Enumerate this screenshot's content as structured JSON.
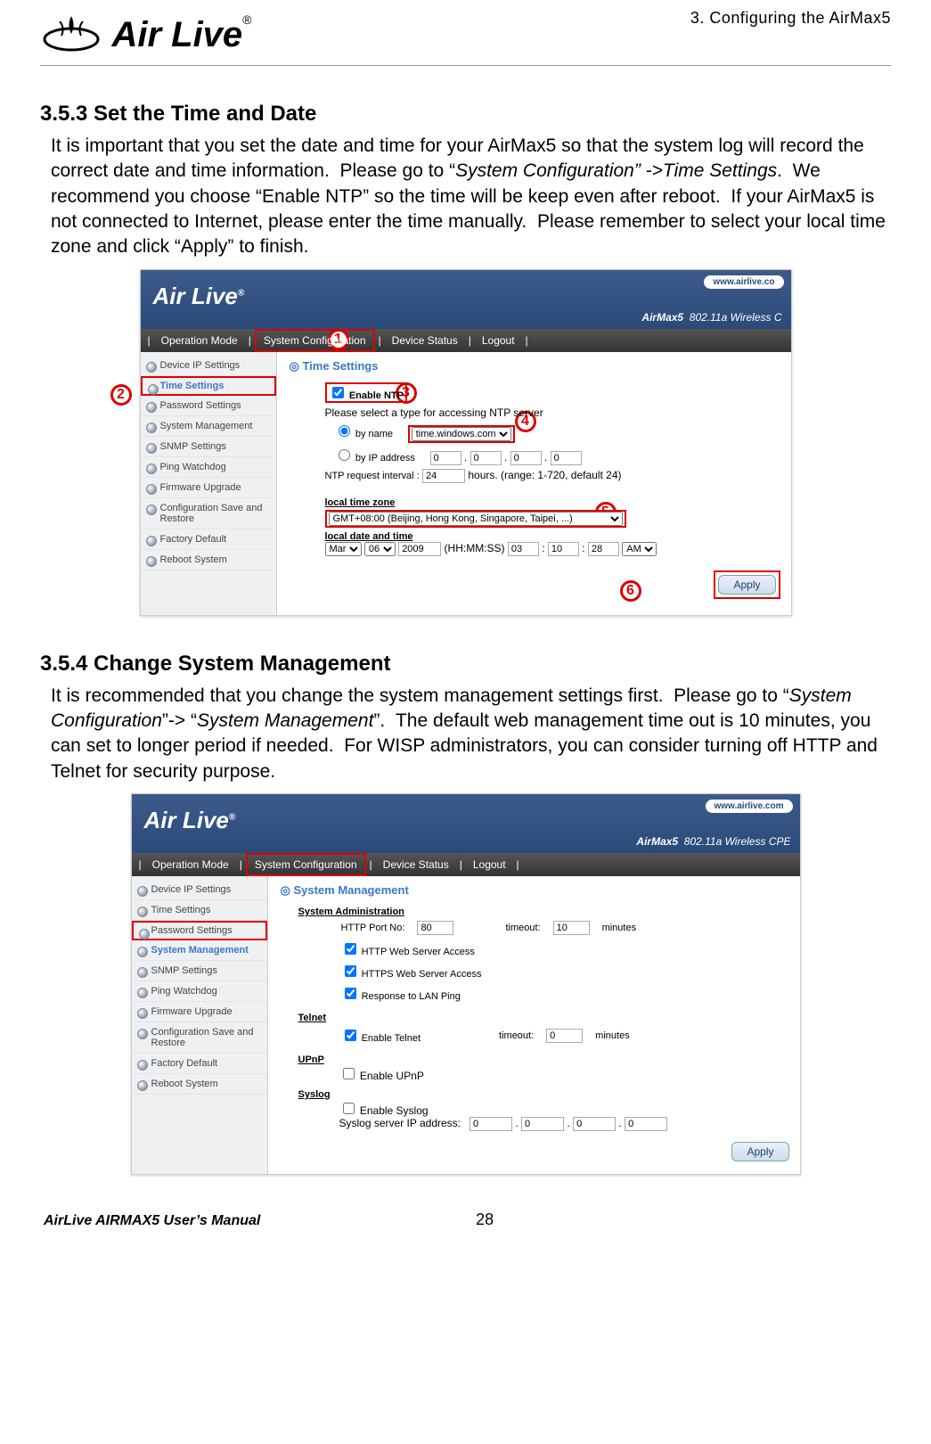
{
  "header": {
    "right": "3. Configuring the AirMax5",
    "logo_text": "Air Live",
    "reg": "®"
  },
  "sec1": {
    "title": "3.5.3 Set the Time and Date",
    "para_a": "It is important that you set the date and time for your AirMax5 so that the system log will record the correct date and time information.  Please go to “",
    "para_b_ital": "System Configuration” ->Time Settings",
    "para_c": ".  We recommend you choose “Enable NTP” so the time will be keep even after reboot.  If your AirMax5 is not connected to Internet, please enter the time manually.  Please remember to select your local time zone and click “Apply” to finish."
  },
  "ss1": {
    "url": "www.airlive.co",
    "product": "AirMax5",
    "tagline": "802.11a Wireless C",
    "nav": [
      "Operation Mode",
      "System Configuration",
      "Device Status",
      "Logout"
    ],
    "side": [
      "Device IP Settings",
      "Time Settings",
      "Password Settings",
      "System Management",
      "SNMP Settings",
      "Ping Watchdog",
      "Firmware Upgrade",
      "Configuration Save and Restore",
      "Factory Default",
      "Reboot System"
    ],
    "page_title": "Time Settings",
    "enable_ntp": "Enable NTP",
    "note": "Please select a type for accessing NTP server",
    "by_name": "by name",
    "ntp_server": "time.windows.com",
    "by_ip": "by IP address",
    "ip": [
      "0",
      "0",
      "0",
      "0"
    ],
    "interval_label": "NTP request interval :",
    "interval": "24",
    "interval_note": "hours. (range: 1-720, default 24)",
    "tz_label": "local time zone",
    "tz": "GMT+08:00 (Beijing, Hong Kong, Singapore, Taipei, ...)",
    "dt_label": "local date and time",
    "mon": "Mar",
    "day": "06",
    "year": "2009",
    "t_label": "(HH:MM:SS)",
    "hh": "03",
    "mm": "10",
    "ss": "28",
    "ampm": "AM",
    "apply": "Apply",
    "badges": [
      "1",
      "2",
      "3",
      "4",
      "5",
      "6"
    ]
  },
  "sec2": {
    "title": "3.5.4 Change System Management",
    "para_a": "It is recommended that you change the system management settings first.  Please go to “",
    "para_b_ital": "System Configuration",
    "para_c": "”-> “",
    "para_d_ital": "System Management",
    "para_e": "”.  The default web management time out is 10 minutes, you can set to longer period if needed.  For WISP administrators, you can consider turning off HTTP and Telnet for security purpose."
  },
  "ss2": {
    "url": "www.airlive.com",
    "product": "AirMax5",
    "tagline": "802.11a Wireless CPE",
    "nav": [
      "Operation Mode",
      "System Configuration",
      "Device Status",
      "Logout"
    ],
    "side": [
      "Device IP Settings",
      "Time Settings",
      "Password Settings",
      "System Management",
      "SNMP Settings",
      "Ping Watchdog",
      "Firmware Upgrade",
      "Configuration Save and Restore",
      "Factory Default",
      "Reboot System"
    ],
    "page_title": "System Management",
    "admin": "System Administration",
    "http_port_l": "HTTP Port No:",
    "http_port": "80",
    "timeout_l": "timeout:",
    "timeout": "10",
    "minutes": "minutes",
    "cb1": "HTTP Web Server Access",
    "cb2": "HTTPS Web Server Access",
    "cb3": "Response to LAN Ping",
    "telnet_h": "Telnet",
    "telnet_cb": "Enable Telnet",
    "telnet_to": "0",
    "upnp_h": "UPnP",
    "upnp_cb": "Enable UPnP",
    "syslog_h": "Syslog",
    "syslog_cb": "Enable Syslog",
    "syslog_ip_l": "Syslog server IP address:",
    "syslog_ip": [
      "0",
      "0",
      "0",
      "0"
    ],
    "apply": "Apply"
  },
  "footer": {
    "left": "AirLive AIRMAX5 User’s Manual",
    "page": "28"
  }
}
